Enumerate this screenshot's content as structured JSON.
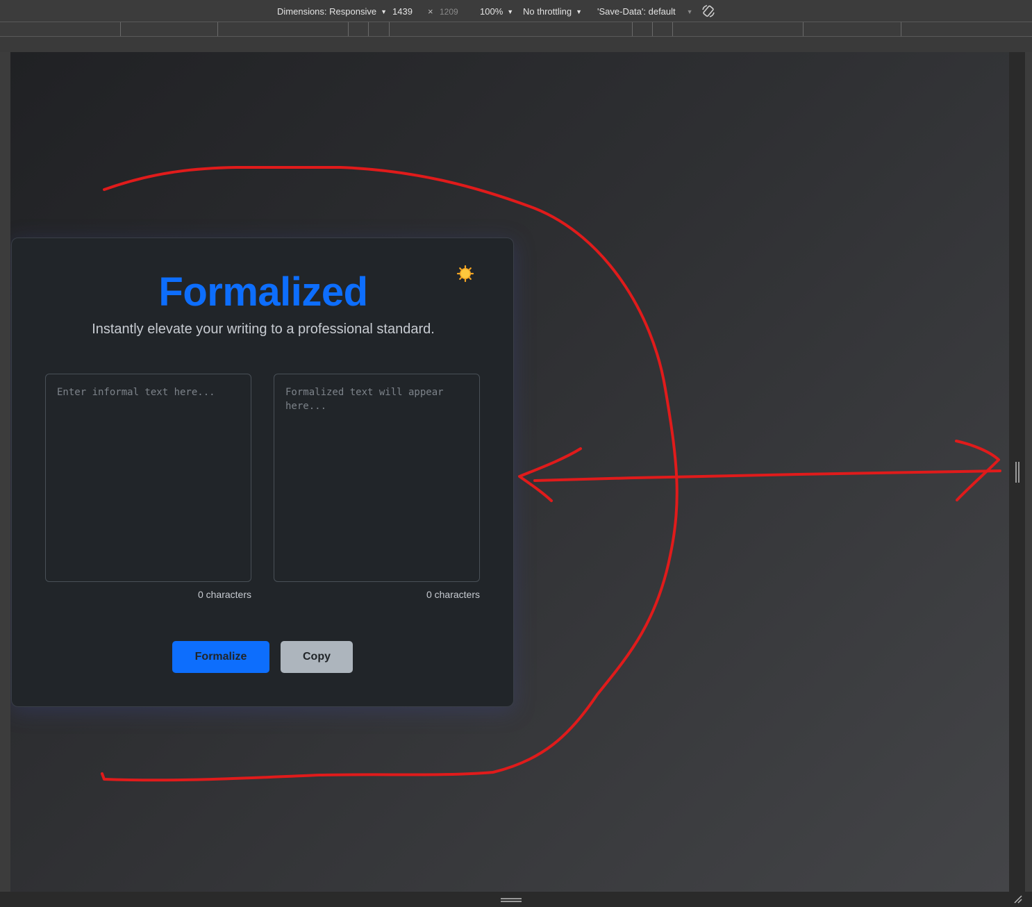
{
  "devtools": {
    "dimensions_label": "Dimensions: Responsive",
    "width_value": "1439",
    "times": "×",
    "height_value": "1209",
    "zoom": "100%",
    "throttling": "No throttling",
    "save_data": "'Save-Data': default"
  },
  "app": {
    "title": "Formalized",
    "subtitle": "Instantly elevate your writing to a professional standard.",
    "input_placeholder": "Enter informal text here...",
    "output_placeholder": "Formalized text will appear here...",
    "input_count": "0 characters",
    "output_count": "0 characters",
    "formalize_label": "Formalize",
    "copy_label": "Copy",
    "theme_icon": "sun-icon"
  },
  "colors": {
    "accent": "#0d6efd",
    "card_bg": "#212529",
    "copy_btn": "#adb5bd",
    "annotation": "#e01b1b",
    "sun": "#f5a623"
  }
}
